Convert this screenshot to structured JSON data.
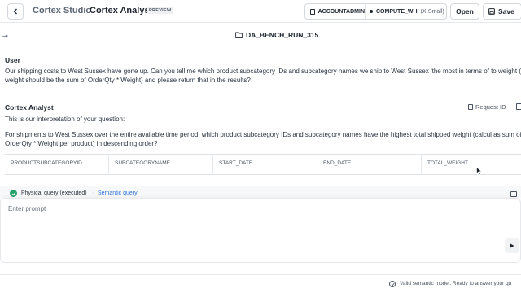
{
  "header": {
    "studio": "Cortex Studio",
    "app": "Cortex Analyst",
    "badge": "PREVIEW",
    "role": "ACCOUNTADMIN",
    "warehouse": "COMPUTE_WH",
    "warehouse_size": "(X-Small)",
    "open_label": "Open",
    "save_label": "Save"
  },
  "file": {
    "title": "DA_BENCH_RUN_315"
  },
  "chat": {
    "user_label": "User",
    "user_message": "Our shipping costs to West Sussex have gone up. Can you tell me which product subcategory IDs and subcategory names we ship to West Sussex 'the most in terms of to weight (total weight should be the sum of OrderQty * Weight) and please return that in the results?",
    "analyst_label": "Cortex Analyst",
    "request_id_label": "Request ID",
    "interp_intro": "This is our interpretation of your question:",
    "interp_question": "For shipments to West Sussex over the entire available time period, which product subcategory IDs and subcategory names have the highest total shipped weight (calcul as sum of OrderQty * Weight per product) in descending order?"
  },
  "table": {
    "columns": [
      "PRODUCTSUBCATEGORYID",
      "SUBCATEGORYNAME",
      "START_DATE",
      "END_DATE",
      "TOTAL_WEIGHT"
    ]
  },
  "query": {
    "physical_label": "Physical query (executed)",
    "separator": "·",
    "semantic_label": "Semantic query"
  },
  "prompt": {
    "placeholder": "Enter prompt"
  },
  "status": {
    "text": "Valid semantic model. Ready to answer your qu"
  },
  "icons": {
    "back": "chevron-left-icon",
    "save": "save-icon",
    "file": "folder-icon",
    "collapse": "collapse-panel-icon",
    "check": "check-circle-icon",
    "send": "send-icon",
    "status": "check-icon"
  },
  "colors": {
    "accent": "#2a6fdb",
    "success": "#26a269"
  }
}
